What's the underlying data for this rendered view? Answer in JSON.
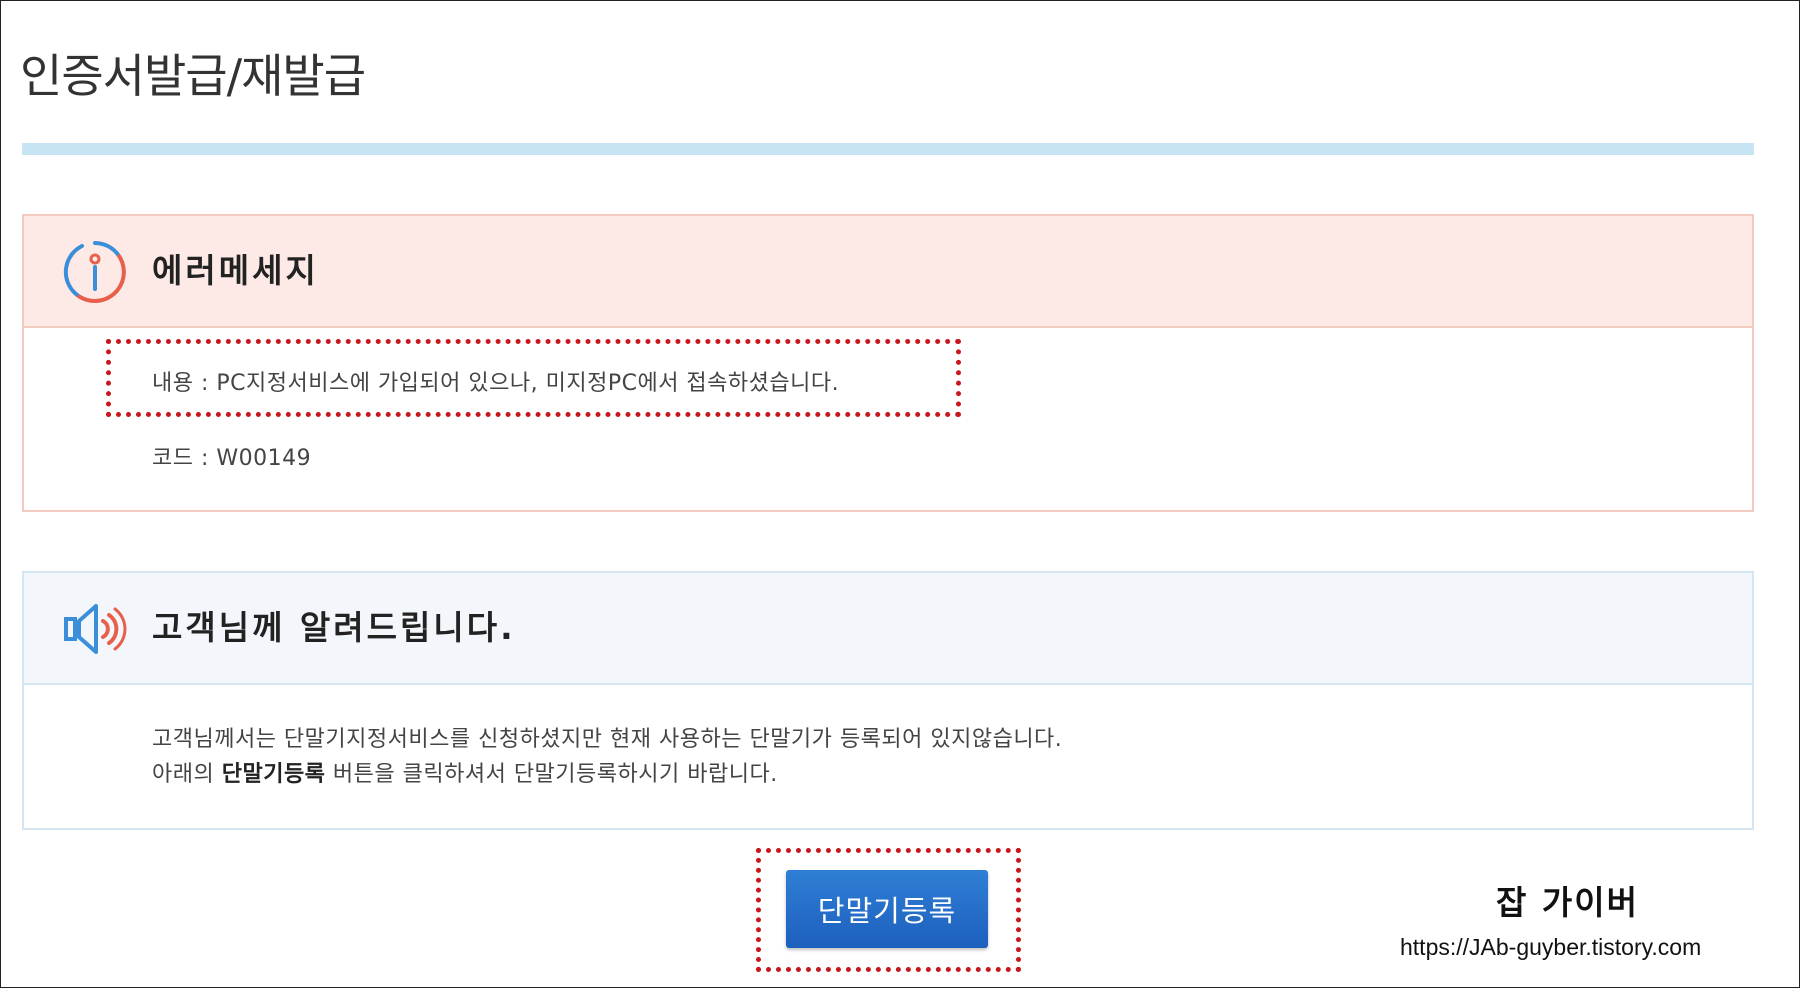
{
  "page": {
    "title": "인증서발급/재발급"
  },
  "error_panel": {
    "icon": "info-icon",
    "title": "에러메세지",
    "content_line": "내용 : PC지정서비스에 가입되어 있으나, 미지정PC에서 접속하셨습니다.",
    "code_line": "코드 : W00149"
  },
  "notice_panel": {
    "icon": "speaker-icon",
    "title": "고객님께 알려드립니다.",
    "line1": "고객님께서는 단말기지정서비스를 신청하셨지만 현재 사용하는 단말기가 등록되어 있지않습니다.",
    "line2_prefix": "아래의 ",
    "line2_bold": "단말기등록",
    "line2_suffix": " 버튼을 클릭하셔서 단말기등록하시기 바랍니다."
  },
  "register_button": {
    "label": "단말기등록"
  },
  "watermark": {
    "name": "잡 가이버",
    "url": "https://JAb-guyber.tistory.com"
  },
  "colors": {
    "title_bar": "#c6e4f4",
    "error_header_bg": "#fdeae6",
    "notice_header_bg": "#f3f7fb",
    "button": "#1d5fbd",
    "highlight": "#c8161d"
  }
}
